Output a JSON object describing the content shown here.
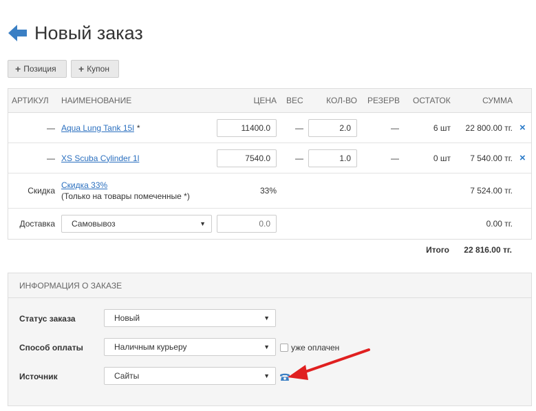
{
  "page": {
    "title": "Новый заказ"
  },
  "toolbar": {
    "add_position": "Позиция",
    "add_coupon": "Купон"
  },
  "table": {
    "headers": {
      "sku": "Артикул",
      "name": "Наименование",
      "price": "Цена",
      "weight": "Вес",
      "qty": "Кол-во",
      "reserve": "Резерв",
      "stock": "Остаток",
      "sum": "Сумма"
    },
    "items": [
      {
        "sku": "—",
        "name": "Aqua Lung Tank 15l",
        "mark": "*",
        "price": "11400.0",
        "weight": "—",
        "qty": "2.0",
        "reserve": "—",
        "stock": "6 шт",
        "sum": "22 800.00 тг."
      },
      {
        "sku": "—",
        "name": "XS Scuba Cylinder 1l",
        "mark": "",
        "price": "7540.0",
        "weight": "—",
        "qty": "1.0",
        "reserve": "—",
        "stock": "0 шт",
        "sum": "7 540.00 тг."
      }
    ],
    "discount": {
      "label": "Скидка",
      "link": "Скидка 33%",
      "note": "(Только на товары помеченные *)",
      "percent": "33%",
      "sum": "7 524.00 тг."
    },
    "delivery": {
      "label": "Доставка",
      "method": "Самовывоз",
      "price_placeholder": "0.0",
      "sum": "0.00 тг."
    }
  },
  "total": {
    "label": "Итого",
    "value": "22 816.00 тг."
  },
  "order_info": {
    "title": "Информация о заказе",
    "status": {
      "label": "Статус заказа",
      "value": "Новый"
    },
    "payment": {
      "label": "Способ оплаты",
      "value": "Наличным курьеру",
      "paid_label": "уже оплачен"
    },
    "source": {
      "label": "Источник",
      "value": "Сайты"
    }
  },
  "colors": {
    "link": "#2a6fbf",
    "accent_blue": "#3a7fc4",
    "arrow_red": "#e02020"
  }
}
